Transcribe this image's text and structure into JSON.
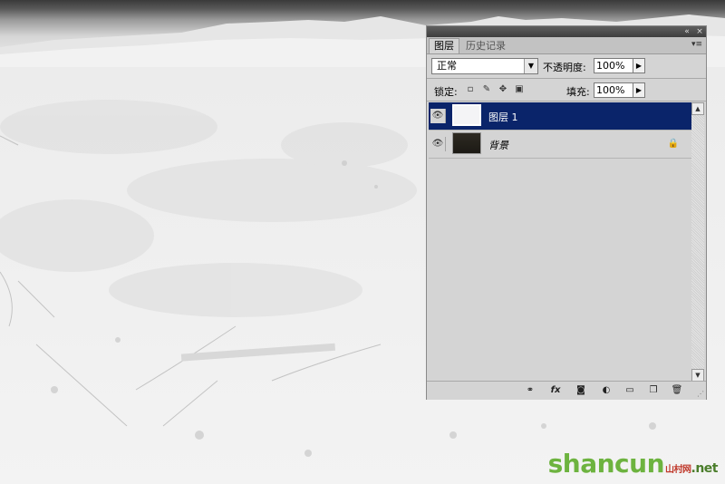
{
  "panel": {
    "tabs": [
      {
        "label": "图层"
      },
      {
        "label": "历史记录"
      }
    ],
    "blend_mode": "正常",
    "opacity_label": "不透明度:",
    "opacity_value": "100%",
    "lock_label": "锁定:",
    "fill_label": "填充:",
    "fill_value": "100%",
    "layers": [
      {
        "name": "图层 1",
        "selected": true,
        "visible": true,
        "thumb": "light"
      },
      {
        "name": "背景",
        "selected": false,
        "visible": true,
        "thumb": "dark",
        "locked": true
      }
    ],
    "lock_icons": [
      "transparency-lock-icon",
      "brush-lock-icon",
      "move-lock-icon",
      "padlock-icon"
    ],
    "footer_icons": [
      "link-icon",
      "fx-icon",
      "mask-icon",
      "adjustment-icon",
      "group-folder-icon",
      "new-layer-icon",
      "trash-icon"
    ]
  },
  "watermark": {
    "brand": "shancun",
    "small": "山村网",
    "suffix": ".net"
  },
  "colors": {
    "selection": "#0a246a",
    "panel_bg": "#d4d4d4"
  }
}
